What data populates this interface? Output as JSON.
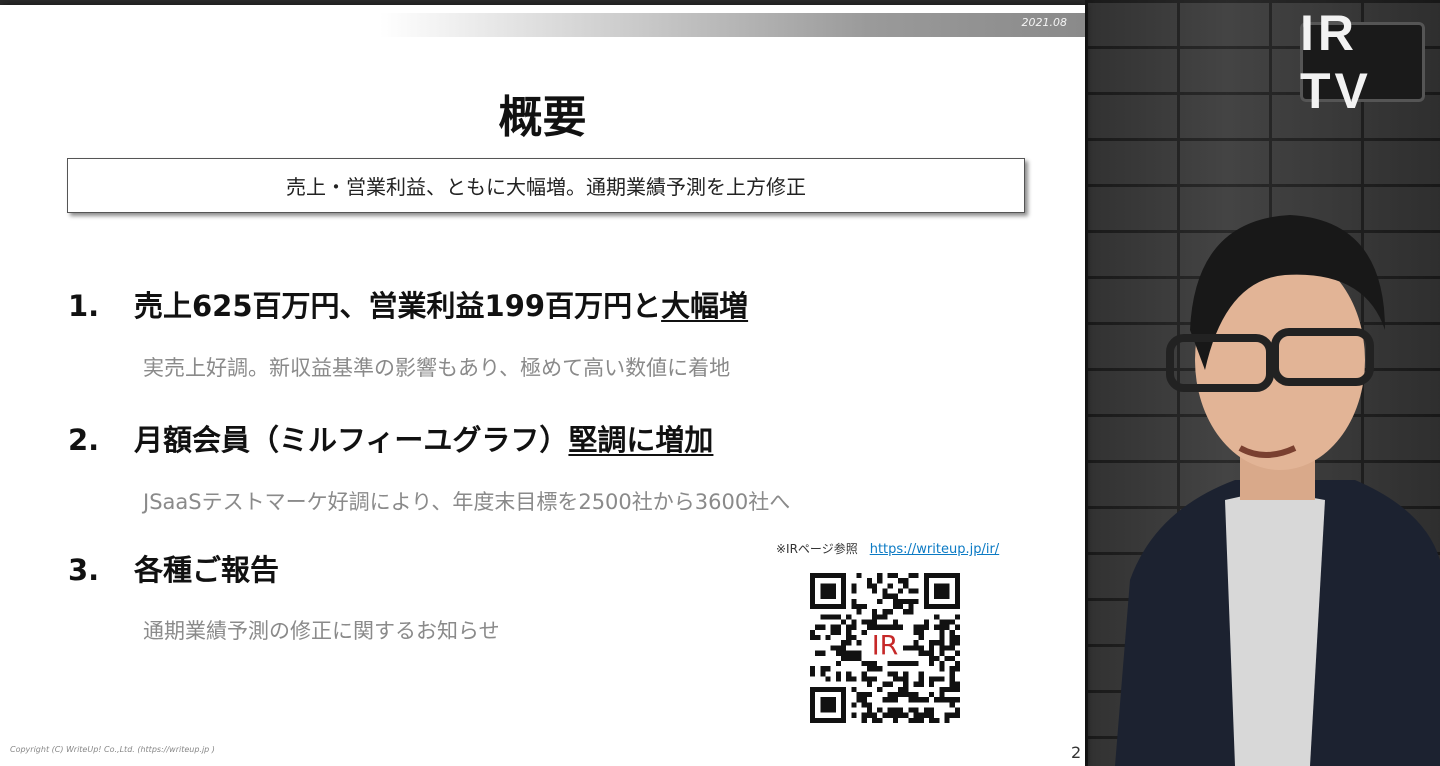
{
  "brand": {
    "logo_text": "IR TV"
  },
  "slide": {
    "date": "2021.08",
    "title": "概要",
    "summary": "売上・営業利益、ともに大幅増。通期業績予測を上方修正",
    "items": [
      {
        "number": "1.",
        "headline": "売上625百万円、営業利益199百万円と",
        "emphasis": "大幅増",
        "detail": "実売上好調。新収益基準の影響もあり、極めて高い数値に着地"
      },
      {
        "number": "2.",
        "headline": "月額会員（ミルフィーユグラフ）",
        "emphasis": "堅調に増加",
        "detail": "JSaaSテストマーケ好調により、年度末目標を2500社から3600社へ"
      },
      {
        "number": "3.",
        "headline": "各種ご報告",
        "emphasis": "",
        "detail": "通期業績予測の修正に関するお知らせ"
      }
    ],
    "ir_note": "※IRページ参照",
    "ir_link": "https://writeup.jp/ir/",
    "qr_center_text": "IR",
    "copyright": "Copyright (C)  WriteUp! Co.,Ltd. (https://writeup.jp )",
    "page_number": "2"
  },
  "colors": {
    "link": "#0b7ac4",
    "qr_accent": "#c62828"
  }
}
